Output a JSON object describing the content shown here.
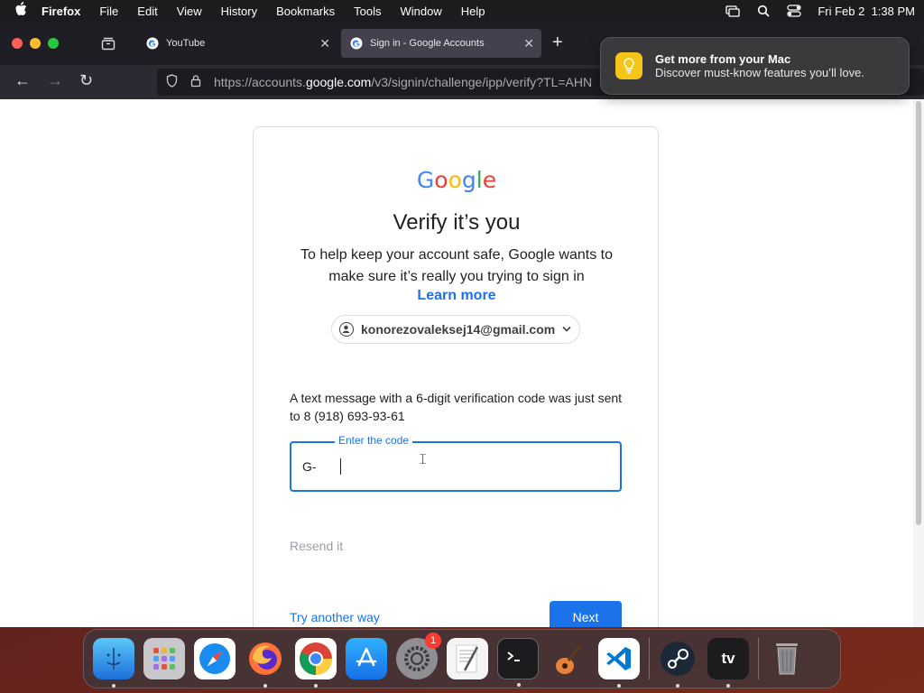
{
  "menubar": {
    "app": "Firefox",
    "items": [
      "File",
      "Edit",
      "View",
      "History",
      "Bookmarks",
      "Tools",
      "Window",
      "Help"
    ],
    "datetime": "Fri Feb 2  1:38 PM"
  },
  "tabs": [
    {
      "title": "YouTube",
      "active": false
    },
    {
      "title": "Sign in - Google Accounts",
      "active": true
    }
  ],
  "url": {
    "prefix": "https://accounts.",
    "host": "google.com",
    "path": "/v3/signin/challenge/ipp/verify?TL=AHN"
  },
  "notification": {
    "title": "Get more from your Mac",
    "body": "Discover must-know features you’ll love."
  },
  "signin": {
    "logo": [
      "G",
      "o",
      "o",
      "g",
      "l",
      "e"
    ],
    "heading": "Verify it’s you",
    "subtitle": "To help keep your account safe, Google wants to make sure it’s really you trying to sign in",
    "learn_more": "Learn more",
    "account": "konorezovaleksej14@gmail.com",
    "message": "A text message with a 6-digit verification code was just sent to 8 (918) 693-93-61",
    "code_label": "Enter the code",
    "code_prefix": "G-",
    "code_value": "",
    "resend": "Resend it",
    "try_another": "Try another way",
    "next": "Next"
  },
  "dock": {
    "apps": [
      "Finder",
      "Launchpad",
      "Safari",
      "Firefox",
      "Chrome",
      "App Store",
      "System Settings",
      "TextEdit",
      "Terminal",
      "GarageBand",
      "VS Code",
      "Steam",
      "TV",
      "Trash"
    ],
    "settings_badge": "1"
  }
}
